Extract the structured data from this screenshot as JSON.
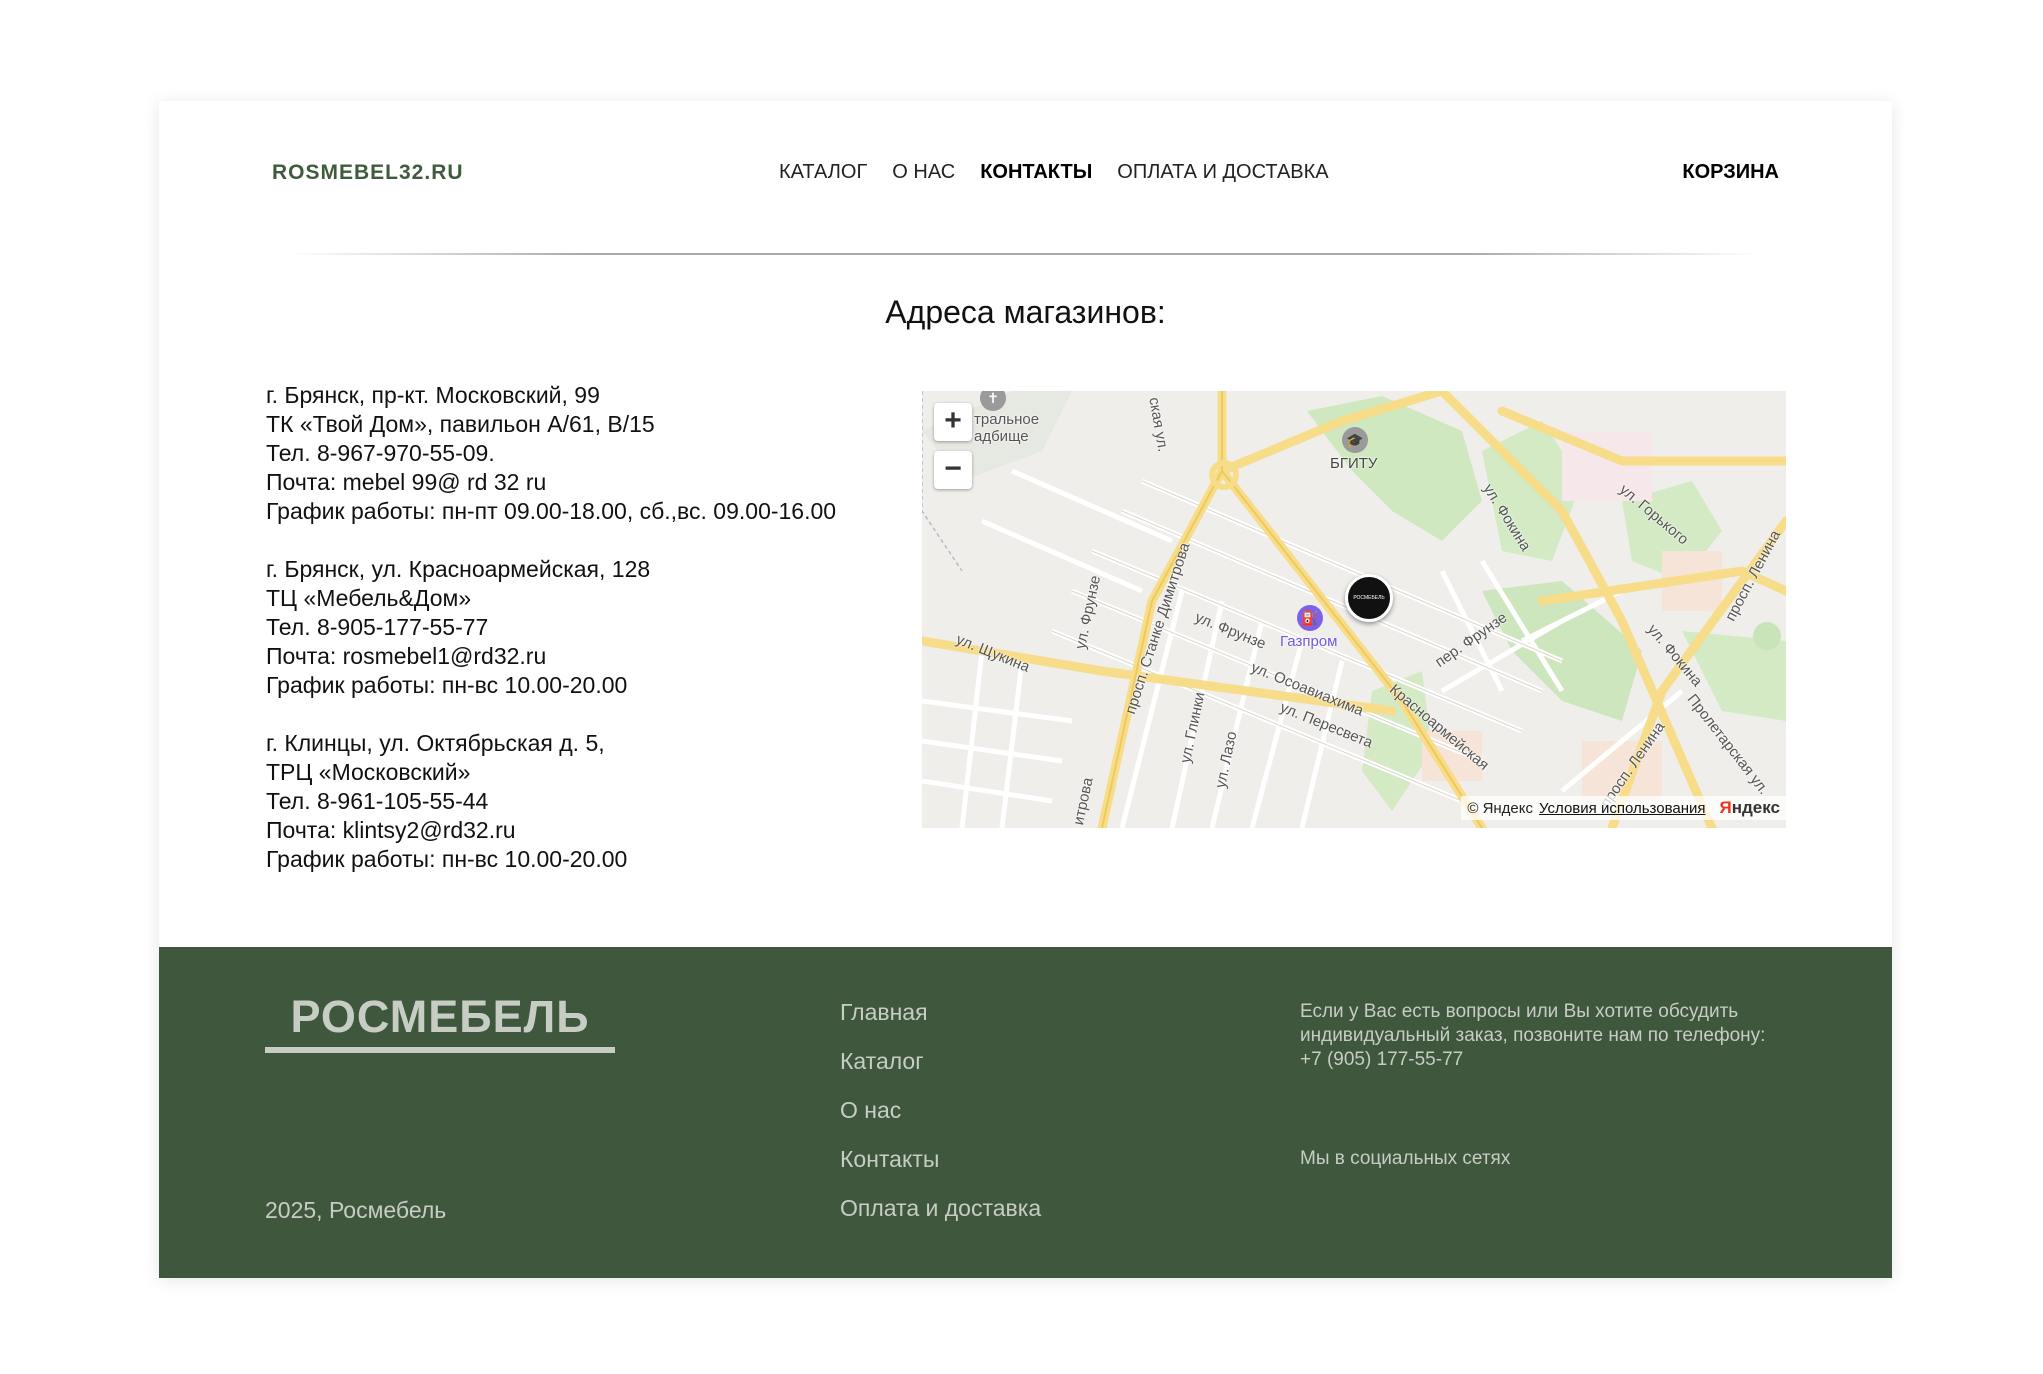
{
  "header": {
    "logo": "ROSMEBEL32.RU",
    "nav": [
      {
        "label": "КАТАЛОГ",
        "active": false
      },
      {
        "label": "О НАС",
        "active": false
      },
      {
        "label": "КОНТАКТЫ",
        "active": true
      },
      {
        "label": "ОПЛАТА И ДОСТАВКА",
        "active": false
      }
    ],
    "cart": "КОРЗИНА"
  },
  "main": {
    "heading": "Адреса магазинов:",
    "stores": [
      {
        "address": "г. Брянск, пр-кт. Московский, 99",
        "place": "ТК «Твой Дом», павильон А/61, В/15",
        "phone": "Тел. 8-967-970-55-09.",
        "email": "Почта: mebel 99@ rd 32 ru",
        "hours": "График работы: пн-пт 09.00-18.00, сб.,вс. 09.00-16.00"
      },
      {
        "address": "г. Брянск, ул. Красноармейская, 128",
        "place": "ТЦ «Мебель&Дом»",
        "phone": "Тел. 8-905-177-55-77",
        "email": "Почта: rosmebel1@rd32.ru",
        "hours": "График работы: пн-вс 10.00-20.00"
      },
      {
        "address": "г. Клинцы, ул. Октябрьская д. 5,",
        "place": "ТРЦ «Московский»",
        "phone": "Тел. 8-961-105-55-44",
        "email": "Почта: klintsy2@rd32.ru",
        "hours": "График работы: пн-вс 10.00-20.00"
      }
    ]
  },
  "map": {
    "zoom_in": "+",
    "zoom_out": "−",
    "labels": {
      "cemetery": "тральное\nадбище",
      "bgitu": "БГИТУ",
      "gazprom": "Газпром",
      "fokina_1": "ул. Фокина",
      "gorkogo": "ул. Горького",
      "lenina_1": "просп. Ленина",
      "fokina_2": "ул. Фокина",
      "proletarskaya": "Пролетарская ул.",
      "lenina_2": "просп. Ленина",
      "dimitrova": "просп. Станке Димитрова",
      "dimitrova_2": "итрова",
      "frunze_1": "ул. Фрунзе",
      "frunze_2": "ул. Фрунзе",
      "frunze_3": "пер. Фрунзе",
      "shchukina": "ул. Щукина",
      "osoaviakhima": "ул. Осоавиахима",
      "peresveta": "ул. Пересвета",
      "krasnoarmeyskaya": "Красноармейская",
      "glinki": "ул. Глинки",
      "lazo": "ул. Лазо",
      "top_street": "ская ул."
    },
    "copyright": "© Яндекс",
    "terms": "Условия использования",
    "brand_first": "Я",
    "brand_rest": "ндекс",
    "marker_label": "РОСМЕБЕЛЬ"
  },
  "footer": {
    "brand": "РОСМЕБЕЛЬ",
    "copyright": "2025, Росмебель",
    "nav": [
      "Главная",
      "Каталог",
      "О нас",
      "Контакты",
      "Оплата и доставка"
    ],
    "contact": "Если у Вас есть вопросы или Вы хотите обсудить индивидуальный заказ, позвоните нам по телефону: +7 (905) 177-55-77",
    "social": "Мы в социальных сетях"
  },
  "colors": {
    "brand_green": "#3e573d",
    "footer_text": "#c7cdc5",
    "logo_green": "#3f5b3d"
  }
}
